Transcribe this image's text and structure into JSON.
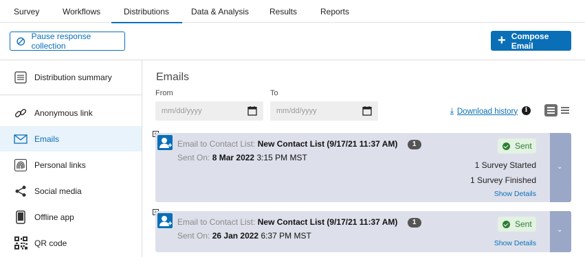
{
  "tabs": [
    "Survey",
    "Workflows",
    "Distributions",
    "Data & Analysis",
    "Results",
    "Reports"
  ],
  "active_tab": "Distributions",
  "actions": {
    "pause_label": "Pause response collection",
    "compose_label": "Compose Email"
  },
  "sidebar": {
    "summary": "Distribution summary",
    "items": [
      {
        "label": "Anonymous link",
        "icon": "link-icon"
      },
      {
        "label": "Emails",
        "icon": "envelope-icon"
      },
      {
        "label": "Personal links",
        "icon": "fingerprint-icon"
      },
      {
        "label": "Social media",
        "icon": "share-icon"
      },
      {
        "label": "Offline app",
        "icon": "phone-icon"
      },
      {
        "label": "QR code",
        "icon": "qr-code-icon"
      }
    ],
    "active": "Emails"
  },
  "main": {
    "title": "Emails",
    "from_label": "From",
    "to_label": "To",
    "from_placeholder": "mm/dd/yyyy",
    "to_placeholder": "mm/dd/yyyy",
    "download_label": "Download history"
  },
  "emails": [
    {
      "prefix": "Email to Contact List:",
      "list_name": "New Contact List (9/17/21 11:37 AM)",
      "count": "1",
      "sent_on_label": "Sent On:",
      "sent_date": "8 Mar 2022",
      "sent_time": "3:15 PM MST",
      "status": "Sent",
      "stat1": "1 Survey Started",
      "stat2": "1 Survey Finished",
      "details": "Show Details"
    },
    {
      "prefix": "Email to Contact List:",
      "list_name": "New Contact List (9/17/21 11:37 AM)",
      "count": "1",
      "sent_on_label": "Sent On:",
      "sent_date": "26 Jan 2022",
      "sent_time": "6:37 PM MST",
      "status": "Sent",
      "details": "Show Details"
    }
  ],
  "colors": {
    "accent": "#0a6fb7",
    "card_bg": "#dde0ea",
    "card_tab": "#9aa7c6",
    "sent_green": "#2e7d32"
  }
}
